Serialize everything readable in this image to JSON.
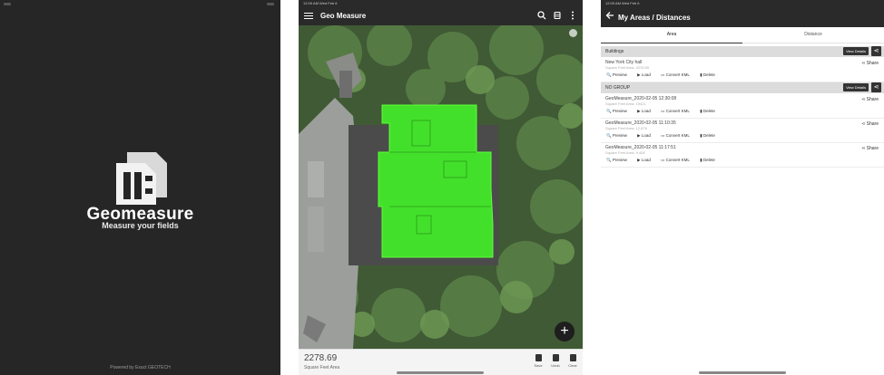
{
  "splash": {
    "app_name": "Geomeasure",
    "tagline": "Measure your fields",
    "powered_by": "Powered by Exact GEOTECH"
  },
  "map_screen": {
    "status_left": "12:09 AM Wed Feb 6",
    "title": "Geo Measure",
    "icons": [
      "menu-icon",
      "search-icon",
      "layers-icon",
      "more-vert-icon"
    ],
    "area_value": "2278.69",
    "area_unit": "Square Feet Area",
    "tools": [
      "Save",
      "Undo",
      "Clear"
    ],
    "fab_label": "+",
    "polygon_color": "#43e02b"
  },
  "list_screen": {
    "status_left": "12:09 AM Wed Feb 6",
    "title": "My Areas / Distances",
    "tabs": [
      "Area",
      "Distance"
    ],
    "active_tab": "Area",
    "view_details": "View Details",
    "share_label": "Share",
    "actions": [
      "Preview",
      "Load",
      "Convert KML",
      "Delete"
    ],
    "groups": [
      {
        "name": "Buildings",
        "items": [
          {
            "name": "New York City hall",
            "subtitle": "Square Feet Area: 2278.69"
          }
        ]
      },
      {
        "name": "NO GROUP",
        "items": [
          {
            "name": "GeoMeasure_2020-02-05 12:30:08",
            "subtitle": "Square Feet Area: 19421"
          },
          {
            "name": "GeoMeasure_2020-02-05 11:10:35",
            "subtitle": "Square Feet Area: 12,876"
          },
          {
            "name": "GeoMeasure_2020-02-05 11:17:51",
            "subtitle": "Square Feet Area: 9,408"
          }
        ]
      }
    ]
  }
}
